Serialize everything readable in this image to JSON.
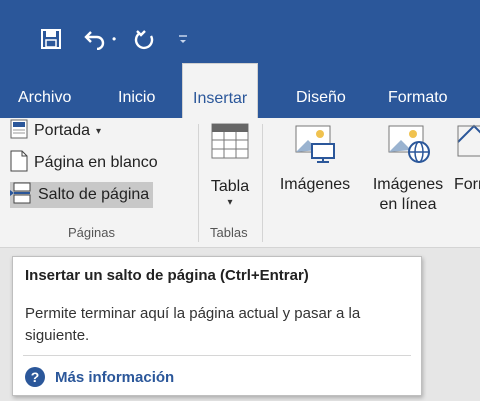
{
  "quick_access": {
    "save_icon": "save-icon",
    "undo_icon": "undo-icon",
    "undo_dropdown_icon": "chevron-down-icon",
    "redo_icon": "redo-icon",
    "customize_icon": "customize-qat-icon"
  },
  "tabs": [
    {
      "label": "Archivo"
    },
    {
      "label": "Inicio"
    },
    {
      "label": "Insertar"
    },
    {
      "label": "Diseño"
    },
    {
      "label": "Formato"
    }
  ],
  "ribbon": {
    "pages_group": {
      "portada": "Portada",
      "pagina_en_blanco": "Página en blanco",
      "salto_de_pagina": "Salto de página",
      "label": "Páginas"
    },
    "tables_group": {
      "tabla": "Tabla",
      "label": "Tablas"
    },
    "illustrations": {
      "imagenes": "Imágenes",
      "imagenes_en_linea_1": "Imágenes",
      "imagenes_en_linea_2": "en línea",
      "formas": "Form"
    }
  },
  "tooltip": {
    "title": "Insertar un salto de página (Ctrl+Entrar)",
    "body": "Permite terminar aquí la página actual y pasar a la siguiente.",
    "more_info": "Más información"
  },
  "colors": {
    "title_bar": "#2b579a",
    "ribbon": "#f3f3f3",
    "highlight": "#c8c8c8"
  }
}
